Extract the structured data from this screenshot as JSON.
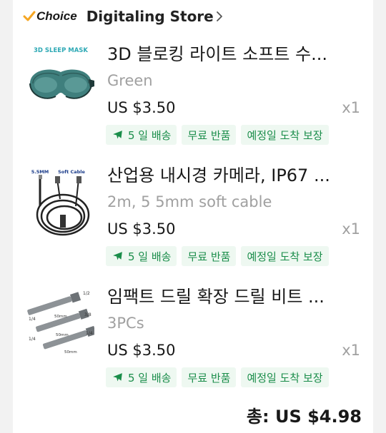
{
  "store": {
    "badge": "Choice",
    "name": "Digitaling Store",
    "accent": "#f5a623"
  },
  "items": [
    {
      "title": "3D 블로킹 라이트 소프트 수...",
      "variant": "Green",
      "price": "US $3.50",
      "qty": "x1",
      "image_label": "3D SLEEP MASK",
      "tags": [
        "5 일 배송",
        "무료 반품",
        "예정일 도착 보장"
      ]
    },
    {
      "title": "산업용 내시경 카메라, IP67 ...",
      "variant": "2m, 5 5mm soft cable",
      "price": "US $3.50",
      "qty": "x1",
      "image_label_left": "5.5MM",
      "image_label_right": "Soft Cable",
      "tags": [
        "5 일 배송",
        "무료 반품",
        "예정일 도착 보장"
      ]
    },
    {
      "title": "임팩트 드릴 확장 드릴 비트 ...",
      "variant": "3PCs",
      "price": "US $3.50",
      "qty": "x1",
      "image_labels": [
        "1/2",
        "3/8",
        "1/4",
        "1/4",
        "1/4",
        "50mm",
        "50mm",
        "50mm"
      ],
      "tags": [
        "5 일 배송",
        "무료 반품",
        "예정일 도착 보장"
      ]
    }
  ],
  "total": {
    "label": "총:",
    "amount": "US $4.98"
  },
  "colors": {
    "tag_text": "#1a8d4a",
    "tag_bg": "#eef8f1",
    "muted": "#a0a0a0"
  }
}
